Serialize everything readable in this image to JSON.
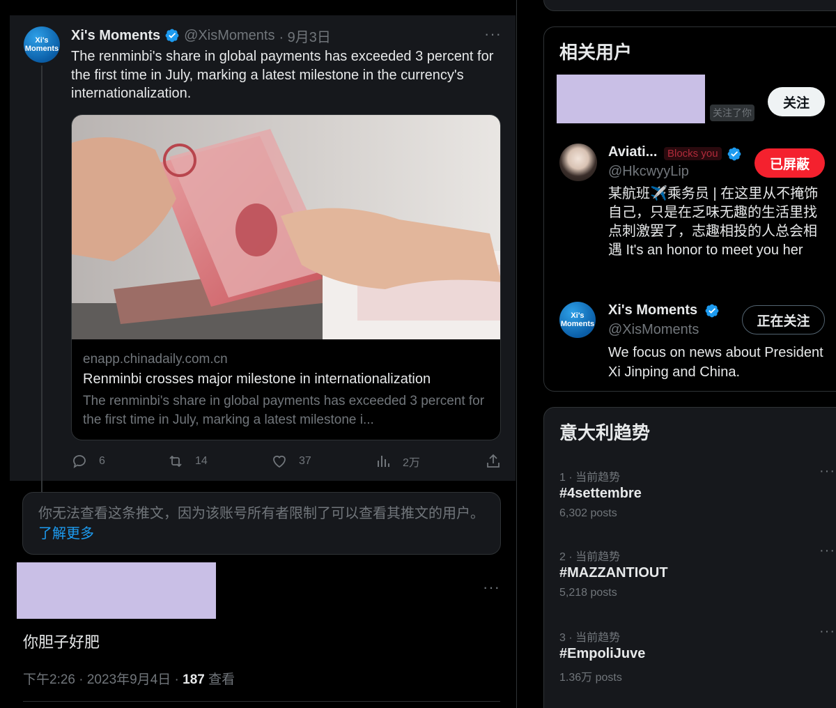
{
  "quoted_tweet": {
    "avatar_line1": "Xi's",
    "avatar_line2": "Moments",
    "author_name": "Xi's Moments",
    "author_handle": "@XisMoments",
    "date": "· 9月3日",
    "more": "···",
    "text": "The renminbi's share in global payments has exceeded 3 percent for the first time in July, marking a latest milestone in the currency's internationalization.",
    "card": {
      "domain": "enapp.chinadaily.com.cn",
      "title": "Renminbi crosses major milestone in internationalization",
      "description": "The renminbi's share in global payments has exceeded 3 percent for the first time in July, marking a latest milestone i..."
    },
    "actions": {
      "replies": "6",
      "retweets": "14",
      "likes": "37",
      "views": "2万"
    }
  },
  "restricted_notice": {
    "text": "你无法查看这条推文，因为该账号所有者限制了可以查看其推文的用户。",
    "link": "了解更多"
  },
  "reply": {
    "more": "···",
    "text": "你胆子好肥",
    "time": "下午2:26 · 2023年9月4日 · ",
    "views_count": "187",
    "views_label": " 查看"
  },
  "related_users": {
    "title": "相关用户",
    "user1": {
      "follows_you": "关注了你",
      "follow_button": "关注"
    },
    "user2": {
      "name": "Aviati...",
      "blocks_you": "Blocks you",
      "handle": "@HkcwyyLip",
      "bio": "某航班✈️乘务员 | 在这里从不掩饰自己，只是在乏味无趣的生活里找点刺激罢了，志趣相投的人总会相遇 It's an honor to meet you her",
      "button": "已屏蔽"
    },
    "user3": {
      "avatar_line1": "Xi's",
      "avatar_line2": "Moments",
      "name": "Xi's Moments",
      "handle": "@XisMoments",
      "bio": "We focus on news about President Xi Jinping and China.",
      "button": "正在关注"
    }
  },
  "trends": {
    "title": "意大利趋势",
    "items": [
      {
        "meta": "1 · 当前趋势",
        "name": "#4settembre",
        "count": "6,302 posts",
        "more": "···"
      },
      {
        "meta": "2 · 当前趋势",
        "name": "#MAZZANTIOUT",
        "count": "5,218 posts",
        "more": "···"
      },
      {
        "meta": "3 · 当前趋势",
        "name": "#EmpoliJuve",
        "count": "1.36万 posts",
        "more": "···"
      }
    ]
  },
  "colors": {
    "accent_blue": "#1d9bf0",
    "block_red": "#f4212e",
    "background": "#000000",
    "panel": "#16181c",
    "redaction": "#c9bfe6"
  }
}
